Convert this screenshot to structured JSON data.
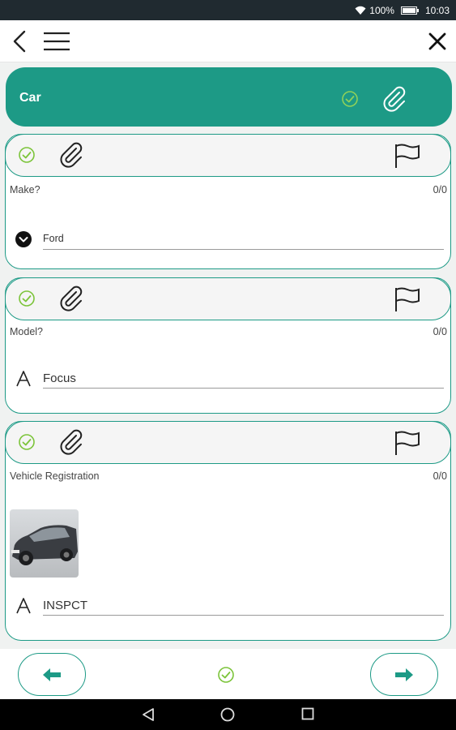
{
  "status_bar": {
    "battery_text": "100%",
    "battery_level": 1.0,
    "time": "10:03"
  },
  "app_bar": {
    "back_icon": "chevron-left-icon",
    "menu_icon": "hamburger-menu-icon",
    "close_icon": "close-icon"
  },
  "section": {
    "title": "Car"
  },
  "questions": [
    {
      "label": "Make?",
      "count": "0/0",
      "answer": "Ford",
      "answer_type": "dropdown"
    },
    {
      "label": "Model?",
      "count": "0/0",
      "answer": "Focus",
      "answer_type": "text"
    },
    {
      "label": "Vehicle Registration",
      "count": "0/0",
      "answer": "INSPCT",
      "answer_type": "text",
      "has_photo": true
    }
  ],
  "colors": {
    "accent": "#1d9a86",
    "check_green": "#7cc43a",
    "status_bar": "#202a30"
  }
}
